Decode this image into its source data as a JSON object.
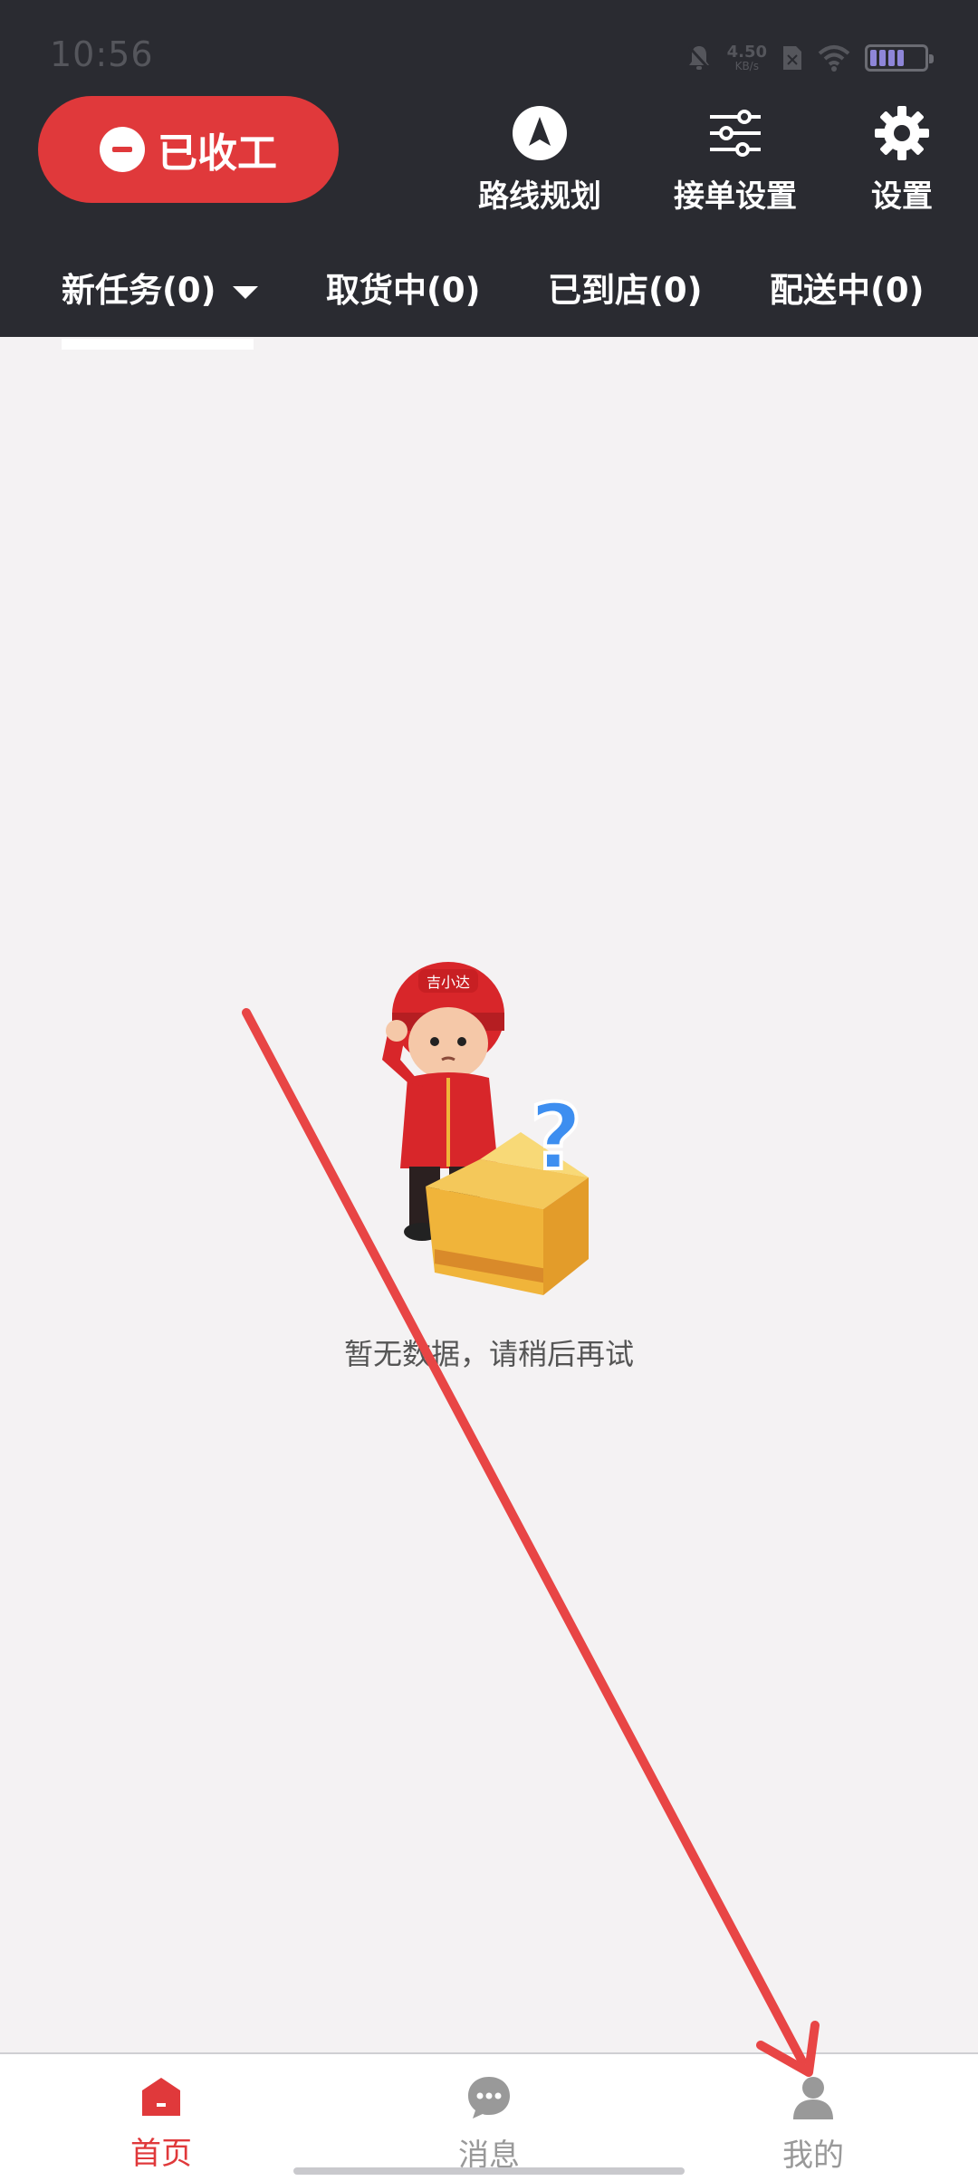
{
  "status_bar": {
    "time": "10:56",
    "net_speed_value": "4.50",
    "net_speed_unit": "KB/s"
  },
  "header": {
    "stop_work_label": "已收工",
    "tools": [
      {
        "label": "路线规划",
        "icon": "navigation-icon"
      },
      {
        "label": "接单设置",
        "icon": "sliders-icon"
      },
      {
        "label": "设置",
        "icon": "gear-icon"
      }
    ]
  },
  "tabs": [
    {
      "label": "新任务(0)",
      "active": true
    },
    {
      "label": "取货中(0)"
    },
    {
      "label": "已到店(0)"
    },
    {
      "label": "配送中(0)"
    }
  ],
  "empty_state": {
    "mascot_text": "吉小达",
    "message": "暂无数据，请稍后再试"
  },
  "bottom_nav": [
    {
      "label": "首页",
      "icon": "home-icon",
      "active": true
    },
    {
      "label": "消息",
      "icon": "message-icon"
    },
    {
      "label": "我的",
      "icon": "user-icon"
    }
  ],
  "colors": {
    "header_bg": "#2a2b31",
    "accent_red": "#e0393b",
    "page_bg": "#f4f2f3"
  }
}
